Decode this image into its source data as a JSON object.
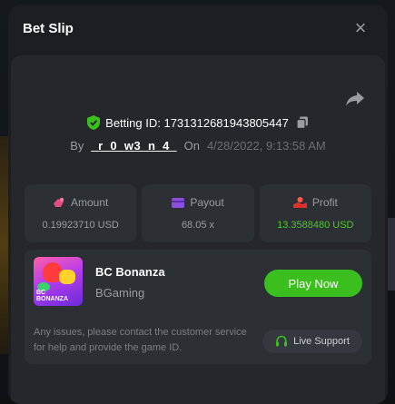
{
  "modal": {
    "title": "Bet Slip",
    "close_icon": "×"
  },
  "bet": {
    "id_label": "Betting ID: 1731312681943805447",
    "by_label": "By",
    "username": "_r_0_w3_n_4_",
    "on_label": "On",
    "date": "4/28/2022, 9:13:58 AM"
  },
  "stats": [
    {
      "label": "Amount",
      "value": "0.19923710 USD",
      "icon": "amount-icon",
      "color": "#e0507a"
    },
    {
      "label": "Payout",
      "value": "68.05 x",
      "icon": "payout-icon",
      "color": "#8a4fe0"
    },
    {
      "label": "Profit",
      "value": "13.3588480 USD",
      "icon": "profit-icon",
      "color": "#e0302a"
    }
  ],
  "game": {
    "name": "BC Bonanza",
    "provider": "BGaming",
    "thumb_text_line1": "BC",
    "thumb_text_line2": "BONANZA",
    "play_label": "Play Now"
  },
  "support": {
    "text": "Any issues, please contact the customer service for help and provide the game ID.",
    "button_label": "Live Support"
  },
  "colors": {
    "accent_green": "#3bbf1e",
    "profit_green": "#4fc72a",
    "shield_green": "#3bbf1e"
  }
}
